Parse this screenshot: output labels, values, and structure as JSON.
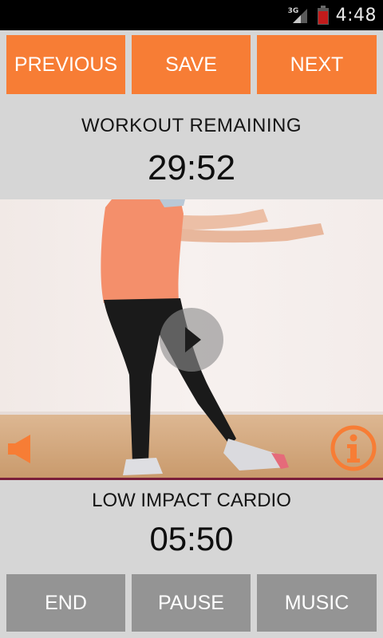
{
  "status_bar": {
    "network_type": "3G",
    "time": "4:48",
    "icons": [
      "signal-icon",
      "battery-icon"
    ]
  },
  "top_buttons": {
    "previous_label": "PREVIOUS",
    "save_label": "SAVE",
    "next_label": "NEXT"
  },
  "workout": {
    "remaining_label": "WORKOUT REMAINING",
    "remaining_time": "29:52"
  },
  "video": {
    "icons": [
      "play-icon",
      "speaker-icon",
      "info-icon"
    ]
  },
  "exercise": {
    "name": "LOW IMPACT CARDIO",
    "time": "05:50"
  },
  "bottom_buttons": {
    "end_label": "END",
    "pause_label": "PAUSE",
    "music_label": "MUSIC"
  },
  "colors": {
    "accent_orange": "#f77d35",
    "button_gray": "#949494",
    "background": "#d6d6d6",
    "status_bar": "#000000"
  }
}
